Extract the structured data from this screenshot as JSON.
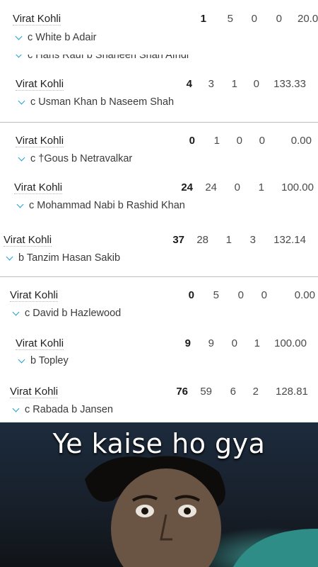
{
  "innings": [
    {
      "name": "Virat Kohli",
      "dismissal": "c White b Adair",
      "runs": "1",
      "balls": "5",
      "fours": "0",
      "sixes": "0",
      "sr": "20.0"
    },
    {
      "dismissal": "c Haris Rauf b Shaheen Shah Afridi"
    },
    {
      "name": "Virat Kohli",
      "dismissal": "c Usman Khan b Naseem Shah",
      "runs": "4",
      "balls": "3",
      "fours": "1",
      "sixes": "0",
      "sr": "133.33"
    },
    {
      "name": "Virat Kohli",
      "dismissal": "c †Gous b Netravalkar",
      "runs": "0",
      "balls": "1",
      "fours": "0",
      "sixes": "0",
      "sr": "0.00"
    },
    {
      "name": "Virat Kohli",
      "dismissal": "c Mohammad Nabi b Rashid Khan",
      "runs": "24",
      "balls": "24",
      "fours": "0",
      "sixes": "1",
      "sr": "100.00"
    },
    {
      "name": "Virat Kohli",
      "dismissal": "b Tanzim Hasan Sakib",
      "runs": "37",
      "balls": "28",
      "fours": "1",
      "sixes": "3",
      "sr": "132.14"
    },
    {
      "name": "Virat Kohli",
      "dismissal": "c David b Hazlewood",
      "runs": "0",
      "balls": "5",
      "fours": "0",
      "sixes": "0",
      "sr": "0.00"
    },
    {
      "name": "Virat Kohli",
      "dismissal": "b Topley",
      "runs": "9",
      "balls": "9",
      "fours": "0",
      "sixes": "1",
      "sr": "100.00"
    },
    {
      "name": "Virat Kohli",
      "dismissal": "c Rabada b Jansen",
      "runs": "76",
      "balls": "59",
      "fours": "6",
      "sixes": "2",
      "sr": "128.81"
    }
  ],
  "meme": {
    "caption": "Ye kaise ho gya"
  },
  "colors": {
    "chevron": "#1ba1d4",
    "divider": "#bdbdbd"
  }
}
